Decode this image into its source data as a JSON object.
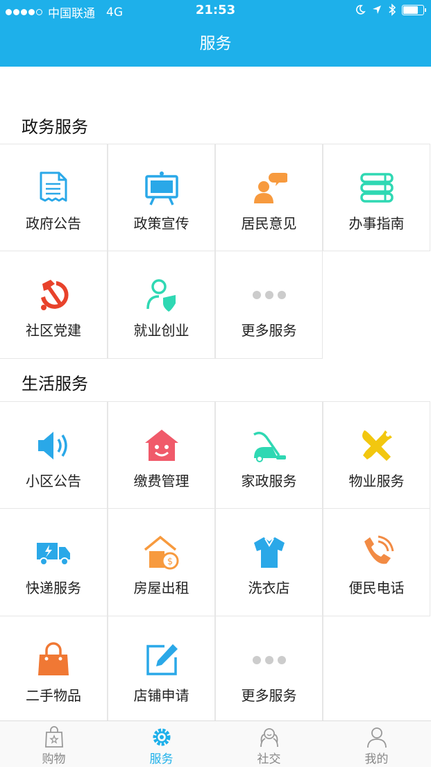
{
  "status_bar": {
    "carrier": "中国联通",
    "network": "4G",
    "time": "21:53"
  },
  "nav": {
    "title": "服务"
  },
  "sections": [
    {
      "title": "政务服务",
      "items": [
        {
          "label": "政府公告",
          "icon": "document-icon"
        },
        {
          "label": "政策宣传",
          "icon": "easel-board-icon"
        },
        {
          "label": "居民意见",
          "icon": "person-speech-icon"
        },
        {
          "label": "办事指南",
          "icon": "books-icon"
        },
        {
          "label": "社区党建",
          "icon": "hammer-sickle-icon"
        },
        {
          "label": "就业创业",
          "icon": "person-shield-icon"
        },
        {
          "label": "更多服务",
          "icon": "more-dots-icon"
        }
      ]
    },
    {
      "title": "生活服务",
      "items": [
        {
          "label": "小区公告",
          "icon": "speaker-icon"
        },
        {
          "label": "缴费管理",
          "icon": "smiling-house-icon"
        },
        {
          "label": "家政服务",
          "icon": "vacuum-cleaner-icon"
        },
        {
          "label": "物业服务",
          "icon": "tools-icon"
        },
        {
          "label": "快递服务",
          "icon": "delivery-truck-icon"
        },
        {
          "label": "房屋出租",
          "icon": "house-coin-icon"
        },
        {
          "label": "洗衣店",
          "icon": "shirt-icon"
        },
        {
          "label": "便民电话",
          "icon": "phone-icon"
        },
        {
          "label": "二手物品",
          "icon": "handbag-icon"
        },
        {
          "label": "店铺申请",
          "icon": "edit-icon"
        },
        {
          "label": "更多服务",
          "icon": "more-dots-icon"
        }
      ]
    }
  ],
  "tabs": [
    {
      "label": "购物",
      "icon": "shopping-bag-icon",
      "active": false
    },
    {
      "label": "服务",
      "icon": "service-gear-icon",
      "active": true
    },
    {
      "label": "社交",
      "icon": "social-icon",
      "active": false
    },
    {
      "label": "我的",
      "icon": "profile-icon",
      "active": false
    }
  ],
  "colors": {
    "primary": "#1eb0ea",
    "blue": "#2aa8e8",
    "orange": "#f79a3e",
    "teal": "#2fd8b3",
    "red": "#e8422b",
    "pink": "#f05a6a",
    "yellow": "#f2c70f",
    "gray": "#cccccc"
  }
}
